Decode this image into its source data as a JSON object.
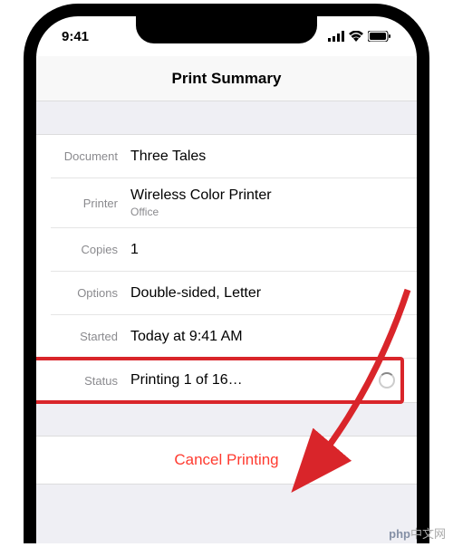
{
  "status_bar": {
    "time": "9:41"
  },
  "header": {
    "title": "Print Summary"
  },
  "rows": {
    "document": {
      "label": "Document",
      "value": "Three Tales"
    },
    "printer": {
      "label": "Printer",
      "value": "Wireless Color Printer",
      "sub": "Office"
    },
    "copies": {
      "label": "Copies",
      "value": "1"
    },
    "options": {
      "label": "Options",
      "value": "Double-sided, Letter"
    },
    "started": {
      "label": "Started",
      "value": "Today at 9:41 AM"
    },
    "status": {
      "label": "Status",
      "value": "Printing 1 of 16…"
    }
  },
  "cancel_button": "Cancel Printing",
  "watermark_text": "中文网"
}
